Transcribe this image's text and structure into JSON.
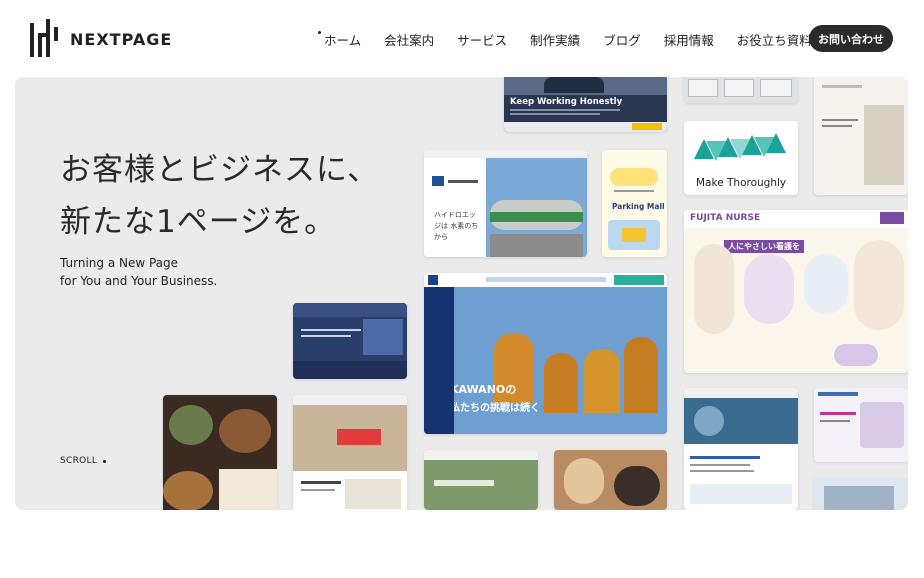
{
  "header": {
    "logo_text": "NEXTPAGE",
    "nav": [
      "ホーム",
      "会社案内",
      "サービス",
      "制作実績",
      "ブログ",
      "採用情報",
      "お役立ち資料"
    ],
    "cta_label": "お問い合わせ"
  },
  "hero": {
    "headline_line1": "お客様とビジネスに、",
    "headline_line2": "新たな1ページを。",
    "sub_line1": "Turning a New Page",
    "sub_line2": "for You and Your Business.",
    "scroll_label": "SCROLL"
  },
  "cards": {
    "komatsu_label": "Keep Working Honestly",
    "make_thoroughly": "Make Thoroughly",
    "parking_mall": "Parking Mall",
    "fujita_nurse": "FUJITA NURSE",
    "fujita_tagline": "人にやさしい看護を",
    "kawano_line1": "KAWANOの",
    "kawano_line2": "私たちの挑戦は続く",
    "hydro_text": "ハイドロエッジは 水素のちから"
  },
  "colors": {
    "hero_bg": "#ebebeb",
    "cta_bg": "#2b2b2b",
    "kawano_blue": "#1b3f8f",
    "fujita_purple": "#7b4aa2",
    "teal": "#1aa39a"
  }
}
